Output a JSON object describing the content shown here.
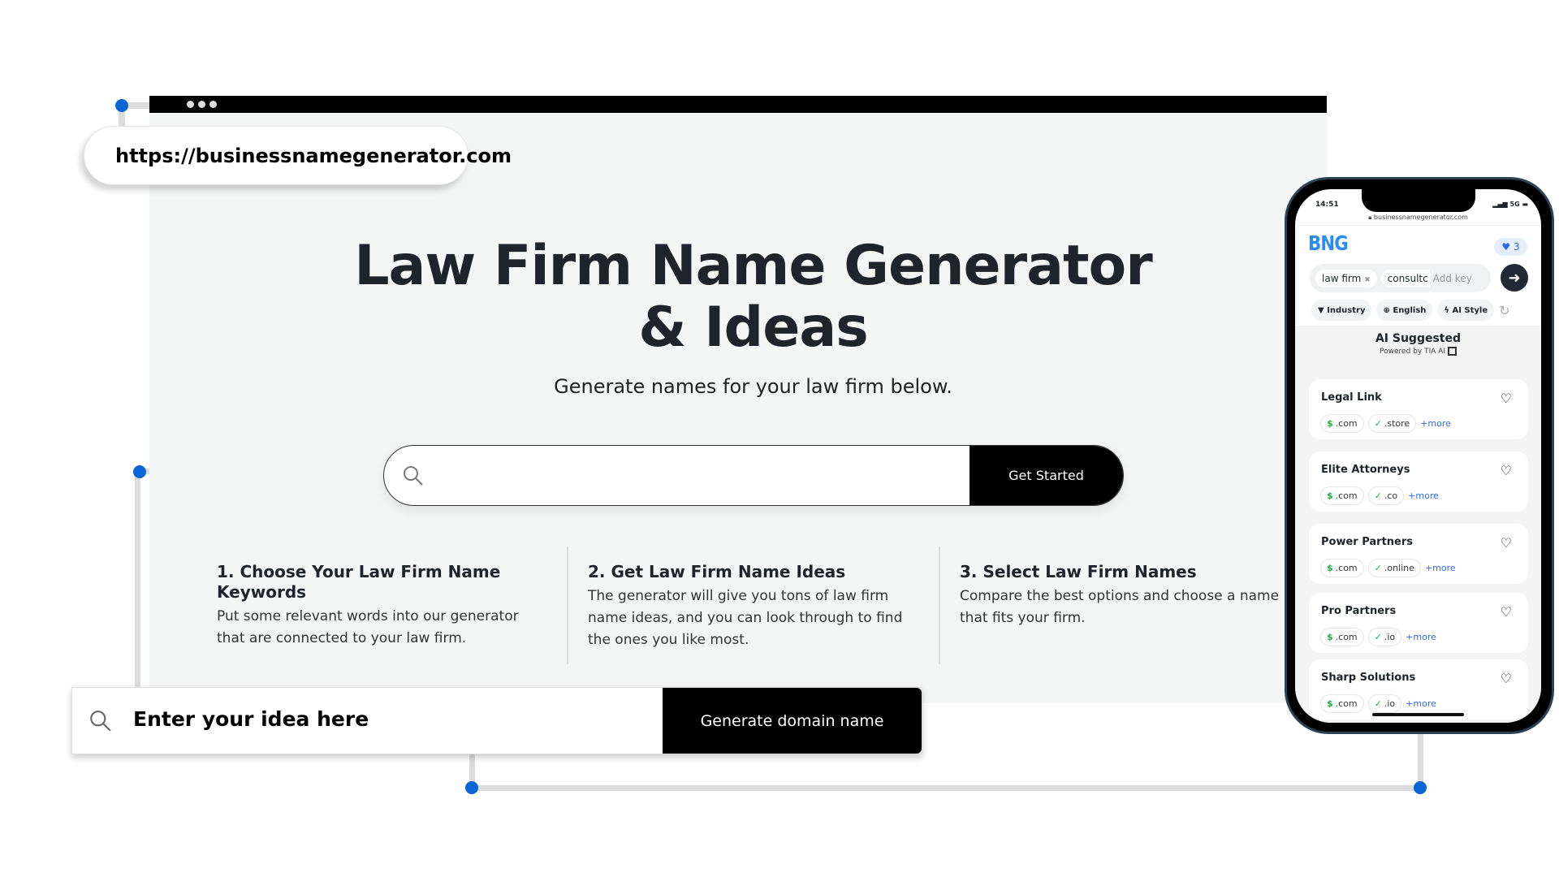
{
  "browser": {
    "url": "https://businessnamegenerator.com"
  },
  "hero": {
    "title": "Law Firm Name Generator & Ideas",
    "subtitle": "Generate names for your law firm below.",
    "search_placeholder": "",
    "cta": "Get Started"
  },
  "steps": [
    {
      "title": "1. Choose Your Law Firm Name Keywords",
      "text": "Put some relevant words into our generator that are connected to your law firm."
    },
    {
      "title": "2. Get Law Firm Name Ideas",
      "text": "The generator will give you tons of law firm name ideas, and you can look through to find the ones you like most."
    },
    {
      "title": "3. Select Law Firm Names",
      "text": "Compare the best options and choose a name that fits your firm."
    }
  ],
  "idea_bar": {
    "placeholder": "Enter your idea here",
    "button": "Generate domain name"
  },
  "phone": {
    "time": "14:51",
    "signal": "5G",
    "url": "businessnamegenerator.com",
    "logo": "BNG",
    "favorites": "3",
    "keywords": [
      "law firm",
      "consultc"
    ],
    "keyword_placeholder": "Add key",
    "filters": [
      "Industry",
      "English",
      "AI Style"
    ],
    "section_title": "AI Suggested",
    "powered_by": "Powered by TIA AI",
    "results": [
      {
        "name": "Legal Link",
        "domains": [
          ".com",
          ".store"
        ],
        "more": "+more"
      },
      {
        "name": "Elite Attorneys",
        "domains": [
          ".com",
          ".co"
        ],
        "more": "+more"
      },
      {
        "name": "Power Partners",
        "domains": [
          ".com",
          ".online"
        ],
        "more": "+more"
      },
      {
        "name": "Pro Partners",
        "domains": [
          ".com",
          ".io"
        ],
        "more": "+more"
      },
      {
        "name": "Sharp Solutions",
        "domains": [
          ".com",
          ".io"
        ],
        "more": "+more"
      }
    ]
  },
  "colors": {
    "accent": "#0a66d6",
    "link": "#2a6af0",
    "available": "#20b040",
    "logo": "#2a8cf5"
  }
}
